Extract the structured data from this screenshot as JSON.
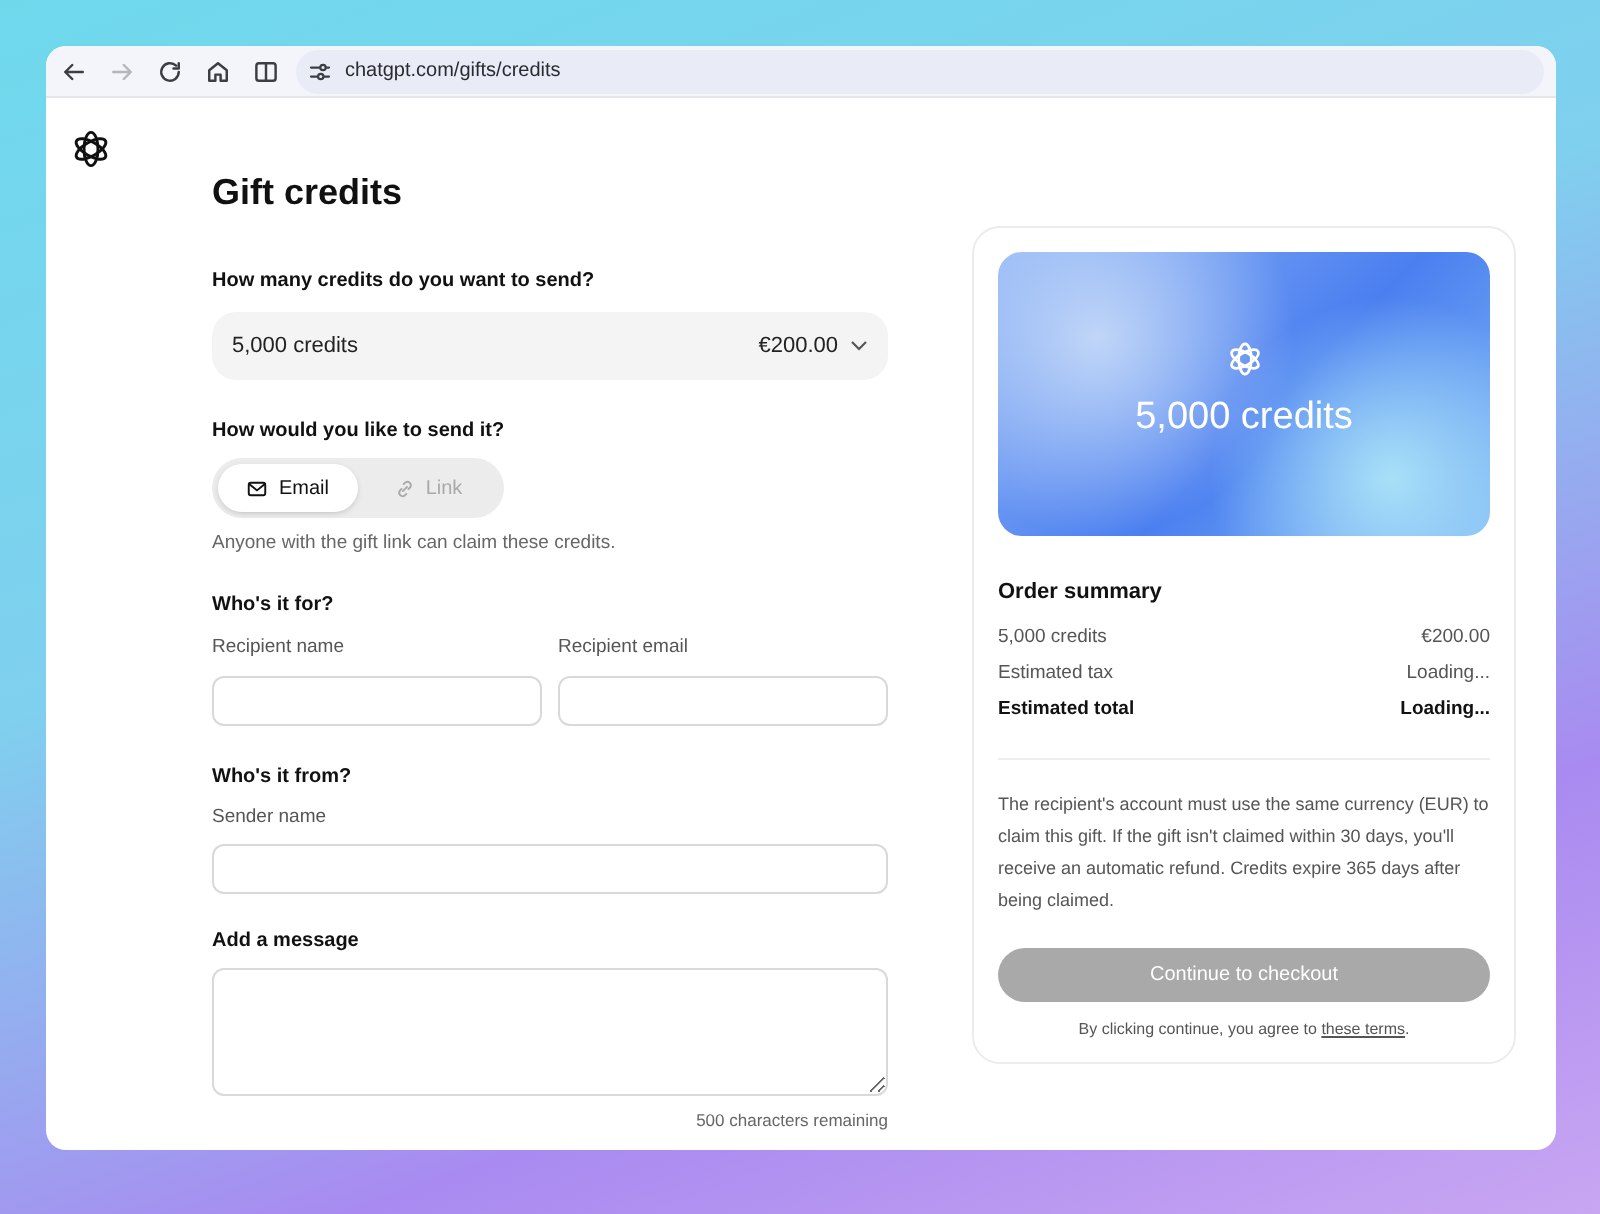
{
  "browser": {
    "url": "chatgpt.com/gifts/credits",
    "forward_disabled": true
  },
  "page": {
    "title": "Gift credits"
  },
  "credits": {
    "label": "How many credits do you want to send?",
    "value": "5,000 credits",
    "price": "€200.00"
  },
  "send_method": {
    "label": "How would you like to send it?",
    "options": [
      {
        "label": "Email",
        "kind": "email",
        "selected": true
      },
      {
        "label": "Link",
        "kind": "link",
        "selected": false
      }
    ],
    "note": "Anyone with the gift link can claim these credits."
  },
  "recipient": {
    "heading": "Who's it for?",
    "fields": [
      {
        "label": "Recipient name"
      },
      {
        "label": "Recipient email"
      }
    ]
  },
  "sender": {
    "heading": "Who's it from?",
    "fields": [
      {
        "label": "Sender name"
      }
    ]
  },
  "message": {
    "heading": "Add a message",
    "counter": "500 characters remaining"
  },
  "summary": {
    "card_text": "5,000 credits",
    "heading": "Order summary",
    "rows": [
      {
        "label": "5,000 credits",
        "value": "€200.00",
        "total": false
      },
      {
        "label": "Estimated tax",
        "value": "Loading...",
        "total": false
      },
      {
        "label": "Estimated total",
        "value": "Loading...",
        "total": true
      }
    ],
    "disclaimer": "The recipient's account must use the same currency (EUR) to claim this gift. If the gift isn't claimed within 30 days, you'll receive an automatic refund. Credits expire 365 days after being claimed.",
    "button": {
      "label": "Continue to checkout",
      "disabled": true
    },
    "terms": {
      "before": "By clicking continue, you agree to ",
      "link": "these terms",
      "after": "."
    }
  }
}
